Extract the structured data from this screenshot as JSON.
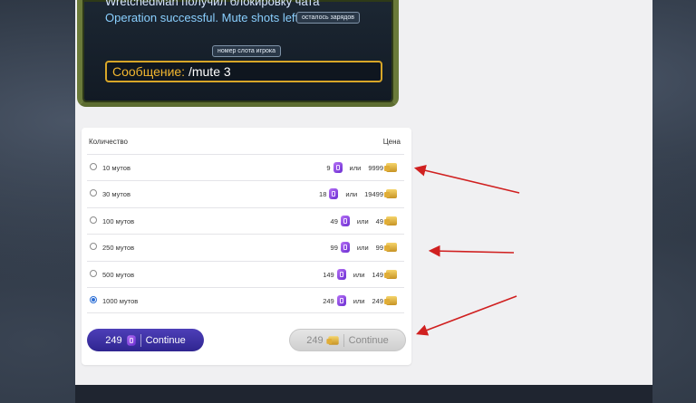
{
  "game_chat": {
    "line1": "WretchedMan получил блокировку чата",
    "line2": "Operation successful. Mute shots left: 9",
    "tooltip_charges": "осталось зарядов",
    "tooltip_slot": "номер слота игрока",
    "message_label": "Сообщение:",
    "message_value": "/mute 3"
  },
  "table": {
    "header_quantity": "Количество",
    "header_price": "Цена",
    "or_label": "или",
    "rows": [
      {
        "label": "10 мутов",
        "gem_price": "9",
        "gold_price": "9999",
        "selected": false
      },
      {
        "label": "30 мутов",
        "gem_price": "18",
        "gold_price": "19499",
        "selected": false
      },
      {
        "label": "100 мутов",
        "gem_price": "49",
        "gold_price": "49",
        "selected": false
      },
      {
        "label": "250 мутов",
        "gem_price": "99",
        "gold_price": "99",
        "selected": false
      },
      {
        "label": "500 мутов",
        "gem_price": "149",
        "gold_price": "149",
        "selected": false
      },
      {
        "label": "1000 мутов",
        "gem_price": "249",
        "gold_price": "249",
        "selected": true
      }
    ]
  },
  "buttons": {
    "gem_amount": "249",
    "gem_label": "Continue",
    "gold_amount": "249",
    "gold_label": "Continue"
  },
  "icons": {
    "gem": "purple-gem-icon",
    "gold": "gold-bars-icon"
  },
  "colors": {
    "gem_button": "#3a2fa3",
    "gold_button": "#d8d8d8",
    "arrow": "#d02020",
    "message_border": "#d8a628"
  }
}
